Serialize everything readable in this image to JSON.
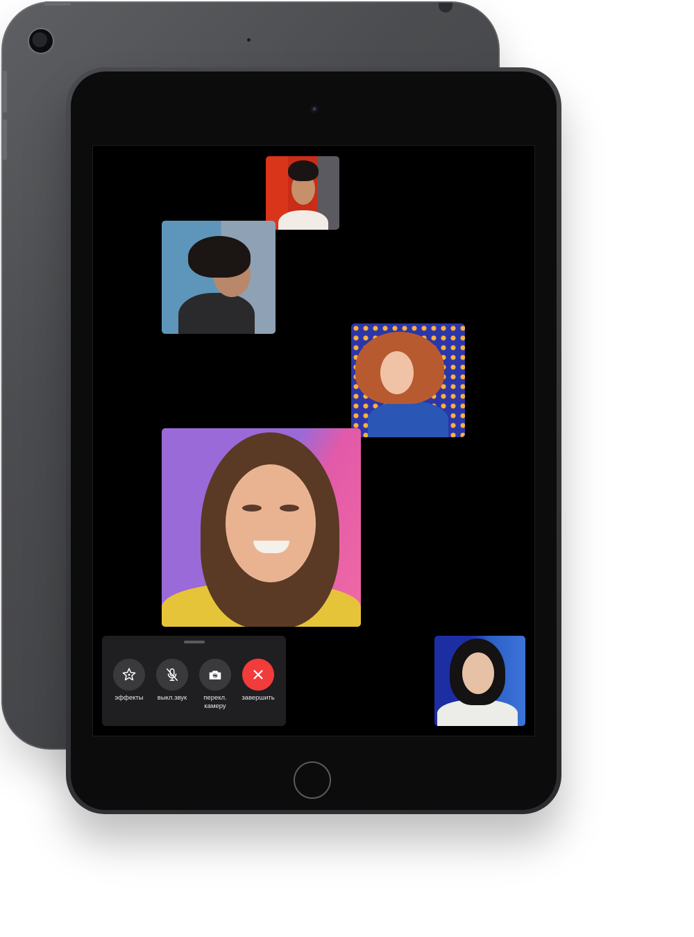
{
  "facetime": {
    "controls": {
      "effects_label": "эффекты",
      "mute_label": "выкл.звук",
      "flip_label": "перекл.\nкамеру",
      "end_label": "завершить"
    },
    "icons": {
      "effects": "star-icon",
      "mute": "mic-off-icon",
      "flip": "camera-flip-icon",
      "end": "close-icon"
    },
    "colors": {
      "end_button": "#f23b3b",
      "control_button": "#3a3a3d",
      "panel": "#1f1f21"
    },
    "participants": [
      {
        "id": "participant-1"
      },
      {
        "id": "participant-2"
      },
      {
        "id": "participant-3"
      },
      {
        "id": "participant-4"
      },
      {
        "id": "participant-5"
      }
    ]
  }
}
